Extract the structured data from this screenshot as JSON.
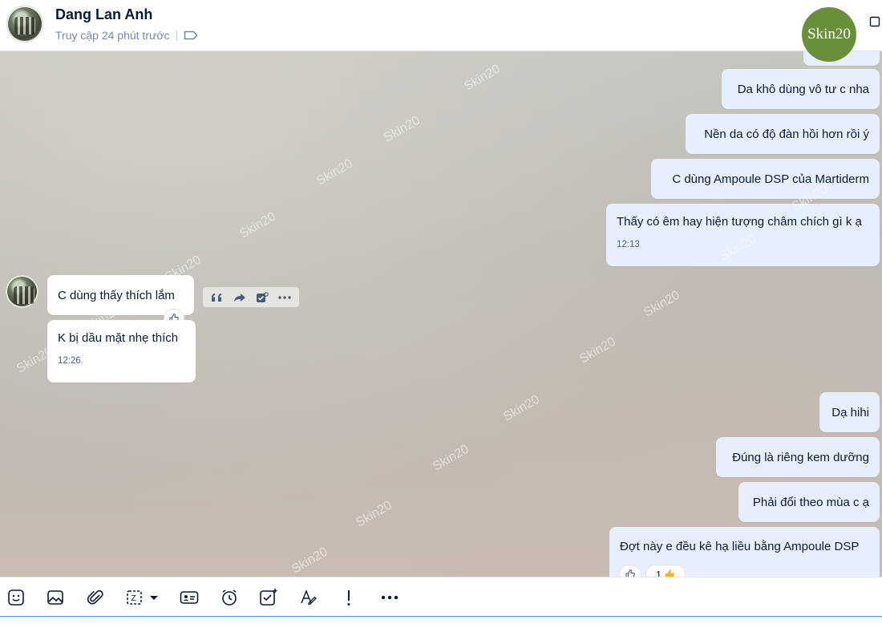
{
  "header": {
    "contact_name": "Dang Lan Anh",
    "last_seen": "Truy cập 24 phút trước",
    "brand_logo_text": "Skin20"
  },
  "watermark_text": "Skin20",
  "messages": {
    "out_1": "Da khô dùng vô tư c nha",
    "out_2": "Nền da có độ đàn hồi hơn rồi ý",
    "out_3": "C dùng Ampoule DSP của Martiderm",
    "out_4": "Thấy có êm hay hiện tượng châm chích gì k ạ",
    "out_4_time": "12:13",
    "in_1": "C dùng thấy thích lắm",
    "in_2": "K bị dầu mặt nhẹ thích",
    "in_2_time": "12:26",
    "out_5": "Dạ hihi",
    "out_6": "Đúng là riêng kem dưỡng",
    "out_7": "Phải đổi theo mùa c ạ",
    "out_8": "Đợt này e đều kê hạ liều bằng Ampoule DSP",
    "out_8_reaction_count": "1"
  },
  "toolbar_icons": [
    "sticker-icon",
    "image-icon",
    "attachment-icon",
    "screenshot-icon",
    "contact-card-icon",
    "reminder-icon",
    "task-icon",
    "format-text-icon",
    "urgent-icon",
    "more-icon"
  ],
  "colors": {
    "outgoing_bubble": "#e5efff",
    "incoming_bubble": "#ffffff",
    "brand_green": "#6a8f3a",
    "input_focus": "#4c8ef5"
  }
}
